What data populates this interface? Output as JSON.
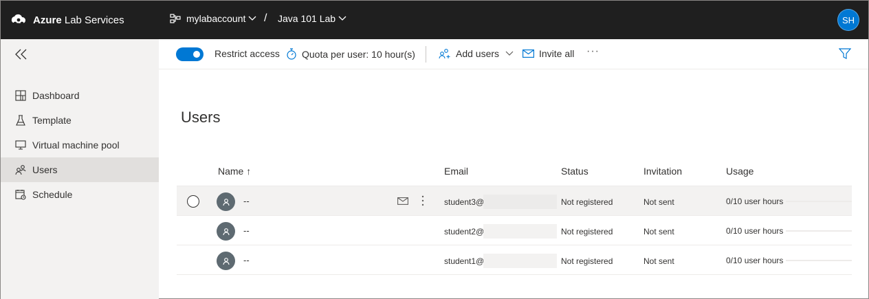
{
  "app": {
    "brand_bold": "Azure",
    "brand_rest": " Lab Services",
    "breadcrumb": [
      {
        "label": "mylabaccount"
      },
      {
        "label": "Java 101 Lab"
      }
    ],
    "breadcrumb_separator": "/",
    "user_initials": "SH"
  },
  "sidebar": {
    "items": [
      {
        "label": "Dashboard",
        "icon": "dashboard-icon"
      },
      {
        "label": "Template",
        "icon": "flask-icon"
      },
      {
        "label": "Virtual machine pool",
        "icon": "monitor-icon"
      },
      {
        "label": "Users",
        "icon": "users-icon",
        "active": true
      },
      {
        "label": "Schedule",
        "icon": "calendar-icon"
      }
    ]
  },
  "commandbar": {
    "restrict_access_label": "Restrict access",
    "restrict_access_on": true,
    "quota_label": "Quota per user: 10 hour(s)",
    "add_users_label": "Add users",
    "invite_all_label": "Invite all",
    "more_label": "···"
  },
  "main": {
    "title": "Users",
    "columns": {
      "name": "Name ↑",
      "email": "Email",
      "status": "Status",
      "invitation": "Invitation",
      "usage": "Usage"
    },
    "rows": [
      {
        "name": "--",
        "email": "student3@",
        "status": "Not registered",
        "invitation": "Not sent",
        "usage": "0/10 user hours",
        "usage_fraction": 0.0
      },
      {
        "name": "--",
        "email": "student2@",
        "status": "Not registered",
        "invitation": "Not sent",
        "usage": "0/10 user hours",
        "usage_fraction": 0.0
      },
      {
        "name": "--",
        "email": "student1@",
        "status": "Not registered",
        "invitation": "Not sent",
        "usage": "0/10 user hours",
        "usage_fraction": 0.0
      }
    ]
  },
  "colors": {
    "topbar": "#1f1f1f",
    "accent": "#0078d4",
    "sidebar_bg": "#f3f2f1",
    "avatar_gray": "#5e6a71"
  }
}
